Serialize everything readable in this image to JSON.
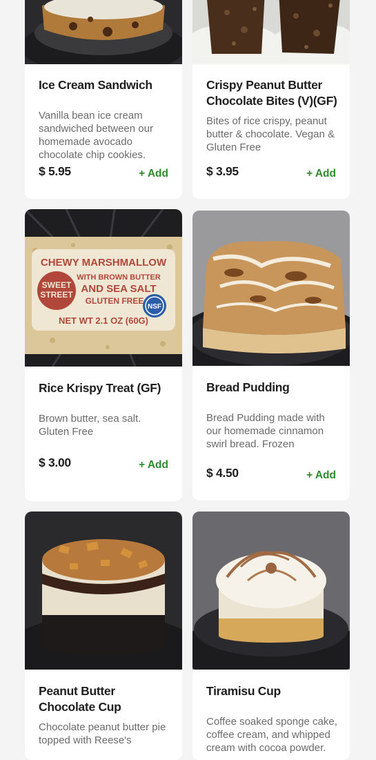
{
  "items": [
    {
      "name": "Ice Cream Sandwich",
      "description": "Vanilla bean ice cream sandwiched between our homemade avocado chocolate chip cookies.",
      "price": "$ 5.95",
      "add_label": "+ Add",
      "image": "ice-cream-sandwich-photo"
    },
    {
      "name": "Crispy Peanut Butter Chocolate Bites (V)(GF)",
      "description": "Bites of rice crispy, peanut butter & chocolate. Vegan & Gluten Free",
      "price": "$ 3.95",
      "add_label": "+ Add",
      "image": "crispy-bites-photo"
    },
    {
      "name": "Rice Krispy Treat (GF)",
      "description": "Brown butter, sea salt. Gluten Free",
      "price": "$ 3.00",
      "add_label": "+ Add",
      "image": "rice-krispy-photo",
      "image_label": {
        "line1": "CHEWY MARSHMALLOW",
        "line2": "WITH BROWN BUTTER",
        "line3": "AND SEA SALT",
        "line4": "GLUTEN FREE",
        "weight": "NET WT 2.1 OZ (60G)",
        "brand1": "SWEET",
        "brand2": "STREET",
        "seal": "NSF"
      }
    },
    {
      "name": "Bread Pudding",
      "description": "Bread Pudding made with our homemade cinnamon swirl bread. Frozen",
      "price": "$ 4.50",
      "add_label": "+ Add",
      "image": "bread-pudding-photo"
    },
    {
      "name": "Peanut Butter Chocolate Cup",
      "description": "Chocolate peanut butter pie topped with Reese's",
      "price": "",
      "add_label": "",
      "image": "pb-cup-photo"
    },
    {
      "name": "Tiramisu Cup",
      "description": "Coffee soaked sponge cake, coffee cream, and whipped cream with cocoa powder.",
      "price": "",
      "add_label": "",
      "image": "tiramisu-photo"
    }
  ],
  "colors": {
    "background": "#f4f4f4",
    "card": "#ffffff",
    "add": "#2e8b2e",
    "text": "#1f1f1f",
    "muted": "#6b6b6b"
  }
}
